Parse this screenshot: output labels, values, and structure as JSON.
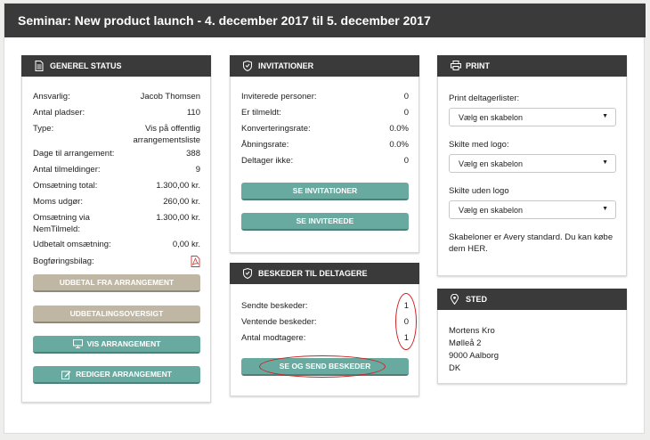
{
  "page_title": "Seminar: New product launch - 4. december 2017 til 5. december 2017",
  "colors": {
    "header_bg": "#3a3a3a",
    "teal_button": "#68aaa0",
    "beige_button": "#bfb7a3",
    "highlight": "#d12020"
  },
  "general_status": {
    "title": "GENEREL STATUS",
    "icon": "document-icon",
    "rows": [
      {
        "label": "Ansvarlig:",
        "value": "Jacob Thomsen"
      },
      {
        "label": "Antal pladser:",
        "value": "110"
      },
      {
        "label": "Type:",
        "value": "Vis på offentlig",
        "value2": "arrangementsliste"
      },
      {
        "label": "Dage til arrangement:",
        "value": "388"
      },
      {
        "label": "Antal tilmeldinger:",
        "value": "9"
      },
      {
        "label": "Omsætning total:",
        "value": "1.300,00 kr."
      },
      {
        "label": "Moms udgør:",
        "value": "260,00 kr."
      },
      {
        "label": "Omsætning via",
        "label2": "NemTilmeld:",
        "value": "1.300,00 kr."
      },
      {
        "label": "Udbetalt omsætning:",
        "value": "0,00 kr."
      },
      {
        "label": "Bogføringsbilag:",
        "value_icon": "pdf-icon"
      }
    ],
    "buttons": [
      {
        "label": "UDBETAL FRA ARRANGEMENT"
      },
      {
        "label": "UDBETALINGSOVERSIGT"
      },
      {
        "label": "VIS ARRANGEMENT",
        "icon": "monitor-icon"
      },
      {
        "label": "REDIGER ARRANGEMENT",
        "icon": "edit-icon"
      }
    ]
  },
  "invitations": {
    "title": "INVITATIONER",
    "icon": "shield-icon",
    "rows": [
      {
        "label": "Inviterede personer:",
        "value": "0"
      },
      {
        "label": "Er tilmeldt:",
        "value": "0"
      },
      {
        "label": "Konverteringsrate:",
        "value": "0.0%"
      },
      {
        "label": "Åbningsrate:",
        "value": "0.0%"
      },
      {
        "label": "Deltager ikke:",
        "value": "0"
      }
    ],
    "buttons": [
      {
        "label": "SE INVITATIONER"
      },
      {
        "label": "SE INVITEREDE"
      }
    ]
  },
  "messages": {
    "title": "BESKEDER TIL DELTAGERE",
    "icon": "shield-icon",
    "rows": [
      {
        "label": "Sendte beskeder:",
        "value": "1"
      },
      {
        "label": "Ventende beskeder:",
        "value": "0"
      },
      {
        "label": "Antal modtagere:",
        "value": "1"
      }
    ],
    "button": {
      "label": "SE OG SEND BESKEDER"
    }
  },
  "print": {
    "title": "PRINT",
    "icon": "printer-icon",
    "groups": [
      {
        "label": "Print deltagerlister:",
        "selected": "Vælg en skabelon"
      },
      {
        "label": "Skilte med logo:",
        "selected": "Vælg en skabelon"
      },
      {
        "label": "Skilte uden logo",
        "selected": "Vælg en skabelon"
      }
    ],
    "note_line1": "Skabeloner er Avery standard. Du kan købe",
    "note_line2": "dem HER."
  },
  "location": {
    "title": "STED",
    "icon": "map-pin-icon",
    "lines": [
      "Mortens Kro",
      "Mølleå 2",
      "9000 Aalborg",
      "DK"
    ]
  }
}
